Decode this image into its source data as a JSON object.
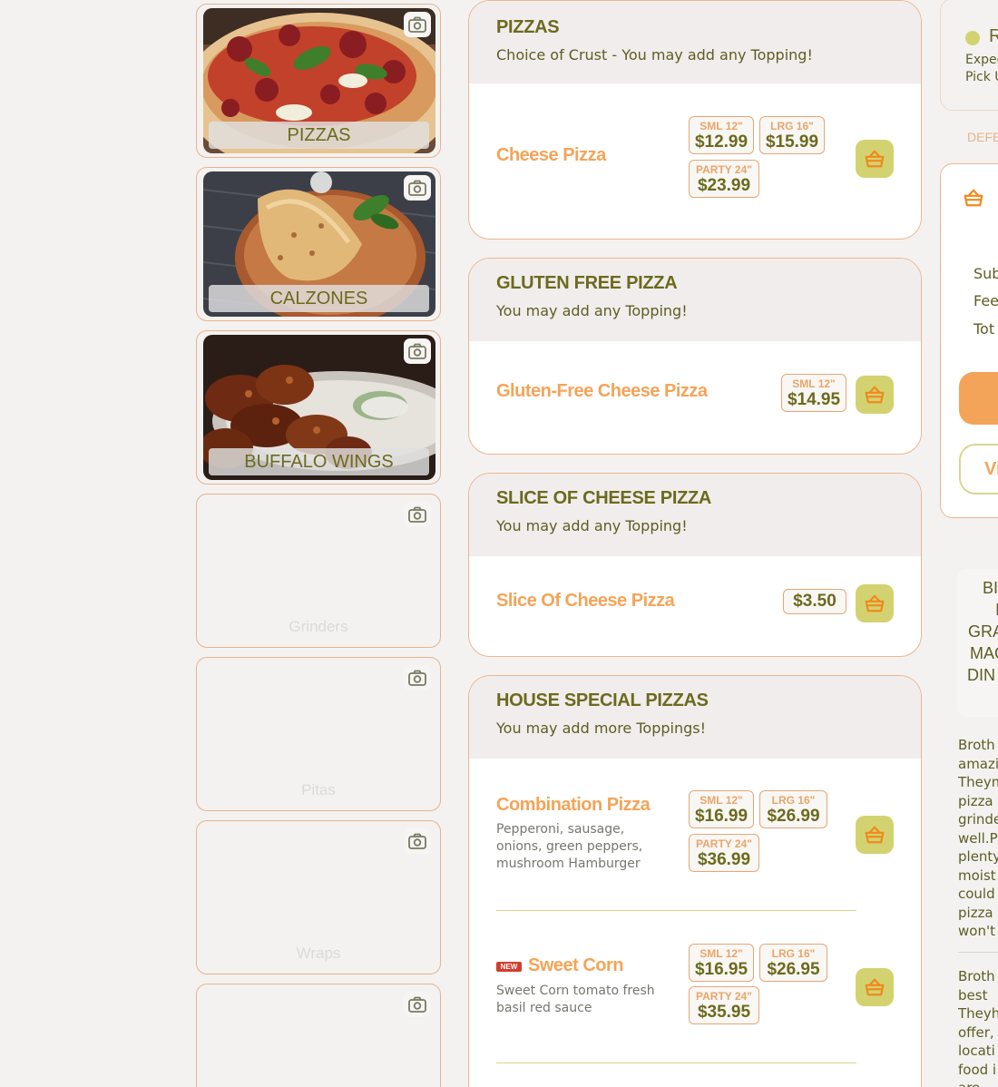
{
  "categories": [
    {
      "label": "PIZZAS",
      "has_image": true,
      "image": "pizza-photo"
    },
    {
      "label": "CALZONES",
      "has_image": true,
      "image": "calzone-photo"
    },
    {
      "label": "BUFFALO WINGS",
      "has_image": true,
      "image": "wings-photo"
    },
    {
      "label": "Grinders",
      "has_image": false
    },
    {
      "label": "Pitas",
      "has_image": false
    },
    {
      "label": "Wraps",
      "has_image": false
    },
    {
      "label": "",
      "has_image": false
    }
  ],
  "sections": {
    "pizzas": {
      "title": "PIZZAS",
      "subtitle": "Choice of Crust - You may add any Topping!",
      "items": [
        {
          "name": "Cheese Pizza",
          "prices": [
            {
              "size": "SML 12\"",
              "value": "$12.99"
            },
            {
              "size": "LRG 16\"",
              "value": "$15.99"
            },
            {
              "size": "PARTY 24\"",
              "value": "$23.99"
            }
          ]
        }
      ]
    },
    "gluten_free": {
      "title": "GLUTEN FREE PIZZA",
      "subtitle": "You may add any Topping!",
      "items": [
        {
          "name": "Gluten-Free Cheese Pizza",
          "prices": [
            {
              "size": "SML 12\"",
              "value": "$14.95"
            }
          ]
        }
      ]
    },
    "slice": {
      "title": "SLICE OF CHEESE PIZZA",
      "subtitle": "You may add any Topping!",
      "items": [
        {
          "name": "Slice Of Cheese Pizza",
          "prices": [
            {
              "size": "",
              "value": "$3.50"
            }
          ]
        }
      ]
    },
    "house_special": {
      "title": "HOUSE SPECIAL PIZZAS",
      "subtitle": "You may add more Toppings!",
      "items": [
        {
          "name": "Combination Pizza",
          "description_lines": [
            "Pepperoni, sausage,",
            "onions, green peppers,",
            "mushroom Hamburger"
          ],
          "prices": [
            {
              "size": "SML 12\"",
              "value": "$16.99"
            },
            {
              "size": "LRG 16\"",
              "value": "$26.99"
            },
            {
              "size": "PARTY 24\"",
              "value": "$36.99"
            }
          ]
        },
        {
          "name": "Sweet Corn",
          "badge": "NEW",
          "description_lines": [
            "Sweet Corn tomato fresh",
            "basil red sauce"
          ],
          "prices": [
            {
              "size": "SML 12\"",
              "value": "$16.95"
            },
            {
              "size": "LRG 16\"",
              "value": "$26.95"
            },
            {
              "size": "PARTY 24\"",
              "value": "$35.95"
            }
          ]
        }
      ]
    }
  },
  "right_panel": {
    "status_label": "R",
    "expect_lines": [
      "Expec",
      "Pick U"
    ],
    "defer_label": "DEFE",
    "totals": [
      "Sub",
      "Fee",
      "Tot"
    ],
    "view_label": "Vi",
    "hours_lines": [
      "BI",
      "I",
      "GRA",
      "MAC",
      "DIN"
    ],
    "review_1": [
      "Broth",
      "amazi",
      "Theym",
      "pizza",
      "grinde",
      "well.P",
      "plenty",
      "moist",
      "could",
      "pizza",
      "won't"
    ],
    "review_2": [
      "Broth",
      "best",
      "Theyh",
      "offer,",
      "locati",
      "food i",
      "are"
    ]
  },
  "colors": {
    "accent_orange": "#f4a458",
    "olive_text": "#6c6a1e",
    "basket_green": "#d3d271",
    "border_orange": "#f0b58e",
    "new_badge": "#d43d2e"
  },
  "icons": {
    "category_corner": "camera-icon",
    "add_to_cart": "basket-icon",
    "cart_header": "basket-icon"
  }
}
